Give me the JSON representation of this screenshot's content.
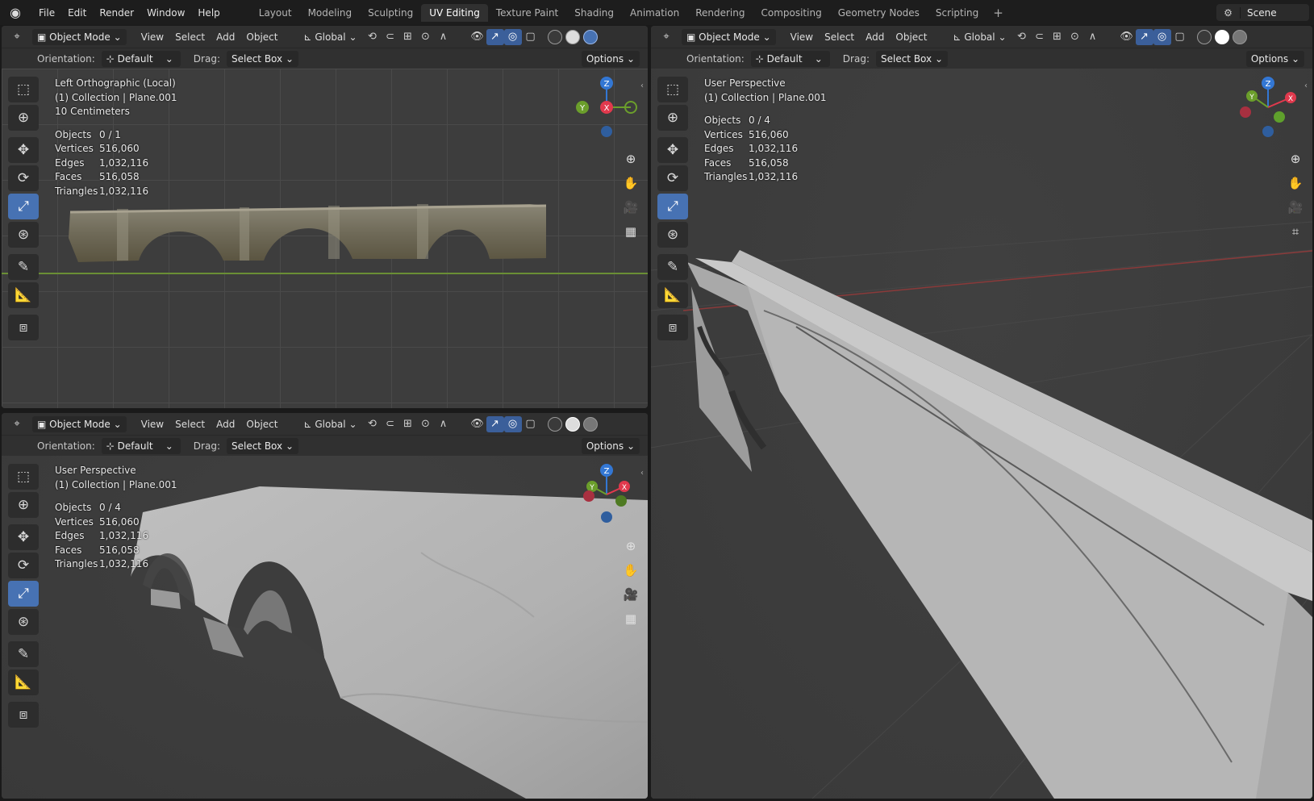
{
  "topbar": {
    "menus": [
      "File",
      "Edit",
      "Render",
      "Window",
      "Help"
    ],
    "workspaces": [
      "Layout",
      "Modeling",
      "Sculpting",
      "UV Editing",
      "Texture Paint",
      "Shading",
      "Animation",
      "Rendering",
      "Compositing",
      "Geometry Nodes",
      "Scripting"
    ],
    "active_workspace": "UV Editing",
    "scene_name": "Scene"
  },
  "header": {
    "mode": "Object Mode",
    "menus": [
      "View",
      "Select",
      "Add",
      "Object"
    ],
    "transform_orientation": "Global",
    "orientation_label": "Orientation:",
    "orientation_value": "Default",
    "drag_label": "Drag:",
    "drag_value": "Select Box",
    "options_label": "Options"
  },
  "viewports": {
    "top_left": {
      "view_name": "Left Orthographic (Local)",
      "collection": "(1) Collection | Plane.001",
      "scale": "10 Centimeters",
      "stats": {
        "Objects": "0 / 1",
        "Vertices": "516,060",
        "Edges": "1,032,116",
        "Faces": "516,058",
        "Triangles": "1,032,116"
      }
    },
    "bottom_left": {
      "view_name": "User Perspective",
      "collection": "(1) Collection | Plane.001",
      "stats": {
        "Objects": "0 / 4",
        "Vertices": "516,060",
        "Edges": "1,032,116",
        "Faces": "516,058",
        "Triangles": "1,032,116"
      }
    },
    "right": {
      "view_name": "User Perspective",
      "collection": "(1) Collection | Plane.001",
      "stats": {
        "Objects": "0 / 4",
        "Vertices": "516,060",
        "Edges": "1,032,116",
        "Faces": "516,058",
        "Triangles": "1,032,116"
      }
    }
  },
  "stat_labels": [
    "Objects",
    "Vertices",
    "Edges",
    "Faces",
    "Triangles"
  ],
  "gizmo_axes": {
    "x": "X",
    "y": "Y",
    "z": "Z"
  },
  "colors": {
    "axis_x": "#e0394d",
    "axis_y": "#6b9e2b",
    "axis_z": "#3377d4",
    "active_tool": "#4772b3",
    "grid_floor_line": "#7ba33a"
  }
}
